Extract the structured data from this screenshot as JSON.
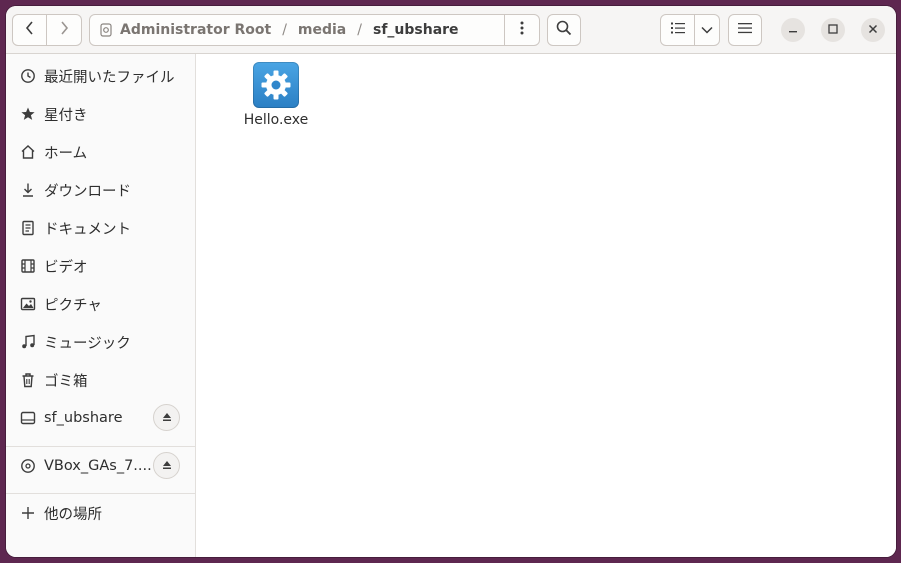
{
  "header": {
    "path": [
      {
        "label": "Administrator Root"
      },
      {
        "label": "media"
      },
      {
        "label": "sf_ubshare"
      }
    ],
    "path_separator": "/"
  },
  "sidebar": {
    "items": [
      {
        "label": "最近開いたファイル",
        "icon": "clock-icon"
      },
      {
        "label": "星付き",
        "icon": "star-icon"
      },
      {
        "label": "ホーム",
        "icon": "home-icon"
      },
      {
        "label": "ダウンロード",
        "icon": "download-icon"
      },
      {
        "label": "ドキュメント",
        "icon": "document-icon"
      },
      {
        "label": "ビデオ",
        "icon": "video-icon"
      },
      {
        "label": "ピクチャ",
        "icon": "picture-icon"
      },
      {
        "label": "ミュージック",
        "icon": "music-icon"
      },
      {
        "label": "ゴミ箱",
        "icon": "trash-icon"
      }
    ],
    "mounts": [
      {
        "label": "sf_ubshare",
        "icon": "drive-icon"
      },
      {
        "label": "VBox_GAs_7....",
        "icon": "disc-icon"
      }
    ],
    "other": {
      "label": "他の場所",
      "icon": "plus-icon"
    }
  },
  "files": [
    {
      "name": "Hello.exe",
      "icon": "gear-icon"
    }
  ],
  "colors": {
    "desktop": "#5e2750",
    "headerbar": "#f6f5f4",
    "exe_icon": "#3a93d6"
  }
}
